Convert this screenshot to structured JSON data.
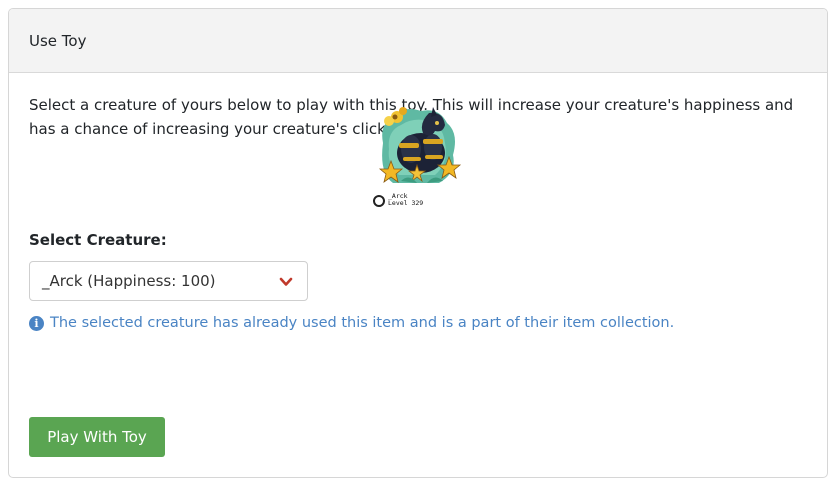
{
  "card": {
    "title": "Use Toy",
    "intro": "Select a creature of yours below to play with this toy. This will increase your creature's happiness and has a chance of increasing your creature's clicks stat."
  },
  "creature": {
    "image_icon": "creature-sprite",
    "name": "_Arck",
    "level": "Level 329"
  },
  "form": {
    "select_label": "Select Creature:",
    "selected_option": "_Arck (Happiness: 100)",
    "info_icon": "info-circle-icon",
    "info_text": "The selected creature has already used this item and is a part of their item collection.",
    "submit_label": "Play With Toy"
  },
  "colors": {
    "header_bg": "#f3f3f3",
    "info_blue": "#4a84c4",
    "button_green": "#5aa552",
    "chevron_red": "#c0392b"
  }
}
